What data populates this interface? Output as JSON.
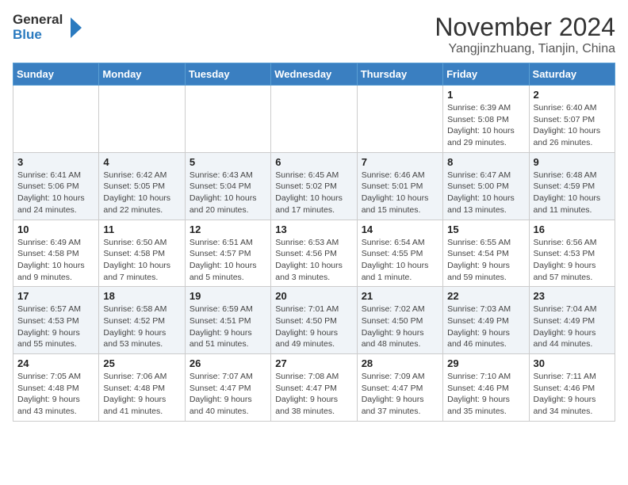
{
  "header": {
    "logo_general": "General",
    "logo_blue": "Blue",
    "month_title": "November 2024",
    "location": "Yangjinzhuang, Tianjin, China"
  },
  "days_of_week": [
    "Sunday",
    "Monday",
    "Tuesday",
    "Wednesday",
    "Thursday",
    "Friday",
    "Saturday"
  ],
  "weeks": [
    [
      {
        "day": "",
        "sunrise": "",
        "sunset": "",
        "daylight": ""
      },
      {
        "day": "",
        "sunrise": "",
        "sunset": "",
        "daylight": ""
      },
      {
        "day": "",
        "sunrise": "",
        "sunset": "",
        "daylight": ""
      },
      {
        "day": "",
        "sunrise": "",
        "sunset": "",
        "daylight": ""
      },
      {
        "day": "",
        "sunrise": "",
        "sunset": "",
        "daylight": ""
      },
      {
        "day": "1",
        "sunrise": "Sunrise: 6:39 AM",
        "sunset": "Sunset: 5:08 PM",
        "daylight": "Daylight: 10 hours and 29 minutes."
      },
      {
        "day": "2",
        "sunrise": "Sunrise: 6:40 AM",
        "sunset": "Sunset: 5:07 PM",
        "daylight": "Daylight: 10 hours and 26 minutes."
      }
    ],
    [
      {
        "day": "3",
        "sunrise": "Sunrise: 6:41 AM",
        "sunset": "Sunset: 5:06 PM",
        "daylight": "Daylight: 10 hours and 24 minutes."
      },
      {
        "day": "4",
        "sunrise": "Sunrise: 6:42 AM",
        "sunset": "Sunset: 5:05 PM",
        "daylight": "Daylight: 10 hours and 22 minutes."
      },
      {
        "day": "5",
        "sunrise": "Sunrise: 6:43 AM",
        "sunset": "Sunset: 5:04 PM",
        "daylight": "Daylight: 10 hours and 20 minutes."
      },
      {
        "day": "6",
        "sunrise": "Sunrise: 6:45 AM",
        "sunset": "Sunset: 5:02 PM",
        "daylight": "Daylight: 10 hours and 17 minutes."
      },
      {
        "day": "7",
        "sunrise": "Sunrise: 6:46 AM",
        "sunset": "Sunset: 5:01 PM",
        "daylight": "Daylight: 10 hours and 15 minutes."
      },
      {
        "day": "8",
        "sunrise": "Sunrise: 6:47 AM",
        "sunset": "Sunset: 5:00 PM",
        "daylight": "Daylight: 10 hours and 13 minutes."
      },
      {
        "day": "9",
        "sunrise": "Sunrise: 6:48 AM",
        "sunset": "Sunset: 4:59 PM",
        "daylight": "Daylight: 10 hours and 11 minutes."
      }
    ],
    [
      {
        "day": "10",
        "sunrise": "Sunrise: 6:49 AM",
        "sunset": "Sunset: 4:58 PM",
        "daylight": "Daylight: 10 hours and 9 minutes."
      },
      {
        "day": "11",
        "sunrise": "Sunrise: 6:50 AM",
        "sunset": "Sunset: 4:58 PM",
        "daylight": "Daylight: 10 hours and 7 minutes."
      },
      {
        "day": "12",
        "sunrise": "Sunrise: 6:51 AM",
        "sunset": "Sunset: 4:57 PM",
        "daylight": "Daylight: 10 hours and 5 minutes."
      },
      {
        "day": "13",
        "sunrise": "Sunrise: 6:53 AM",
        "sunset": "Sunset: 4:56 PM",
        "daylight": "Daylight: 10 hours and 3 minutes."
      },
      {
        "day": "14",
        "sunrise": "Sunrise: 6:54 AM",
        "sunset": "Sunset: 4:55 PM",
        "daylight": "Daylight: 10 hours and 1 minute."
      },
      {
        "day": "15",
        "sunrise": "Sunrise: 6:55 AM",
        "sunset": "Sunset: 4:54 PM",
        "daylight": "Daylight: 9 hours and 59 minutes."
      },
      {
        "day": "16",
        "sunrise": "Sunrise: 6:56 AM",
        "sunset": "Sunset: 4:53 PM",
        "daylight": "Daylight: 9 hours and 57 minutes."
      }
    ],
    [
      {
        "day": "17",
        "sunrise": "Sunrise: 6:57 AM",
        "sunset": "Sunset: 4:53 PM",
        "daylight": "Daylight: 9 hours and 55 minutes."
      },
      {
        "day": "18",
        "sunrise": "Sunrise: 6:58 AM",
        "sunset": "Sunset: 4:52 PM",
        "daylight": "Daylight: 9 hours and 53 minutes."
      },
      {
        "day": "19",
        "sunrise": "Sunrise: 6:59 AM",
        "sunset": "Sunset: 4:51 PM",
        "daylight": "Daylight: 9 hours and 51 minutes."
      },
      {
        "day": "20",
        "sunrise": "Sunrise: 7:01 AM",
        "sunset": "Sunset: 4:50 PM",
        "daylight": "Daylight: 9 hours and 49 minutes."
      },
      {
        "day": "21",
        "sunrise": "Sunrise: 7:02 AM",
        "sunset": "Sunset: 4:50 PM",
        "daylight": "Daylight: 9 hours and 48 minutes."
      },
      {
        "day": "22",
        "sunrise": "Sunrise: 7:03 AM",
        "sunset": "Sunset: 4:49 PM",
        "daylight": "Daylight: 9 hours and 46 minutes."
      },
      {
        "day": "23",
        "sunrise": "Sunrise: 7:04 AM",
        "sunset": "Sunset: 4:49 PM",
        "daylight": "Daylight: 9 hours and 44 minutes."
      }
    ],
    [
      {
        "day": "24",
        "sunrise": "Sunrise: 7:05 AM",
        "sunset": "Sunset: 4:48 PM",
        "daylight": "Daylight: 9 hours and 43 minutes."
      },
      {
        "day": "25",
        "sunrise": "Sunrise: 7:06 AM",
        "sunset": "Sunset: 4:48 PM",
        "daylight": "Daylight: 9 hours and 41 minutes."
      },
      {
        "day": "26",
        "sunrise": "Sunrise: 7:07 AM",
        "sunset": "Sunset: 4:47 PM",
        "daylight": "Daylight: 9 hours and 40 minutes."
      },
      {
        "day": "27",
        "sunrise": "Sunrise: 7:08 AM",
        "sunset": "Sunset: 4:47 PM",
        "daylight": "Daylight: 9 hours and 38 minutes."
      },
      {
        "day": "28",
        "sunrise": "Sunrise: 7:09 AM",
        "sunset": "Sunset: 4:47 PM",
        "daylight": "Daylight: 9 hours and 37 minutes."
      },
      {
        "day": "29",
        "sunrise": "Sunrise: 7:10 AM",
        "sunset": "Sunset: 4:46 PM",
        "daylight": "Daylight: 9 hours and 35 minutes."
      },
      {
        "day": "30",
        "sunrise": "Sunrise: 7:11 AM",
        "sunset": "Sunset: 4:46 PM",
        "daylight": "Daylight: 9 hours and 34 minutes."
      }
    ]
  ]
}
